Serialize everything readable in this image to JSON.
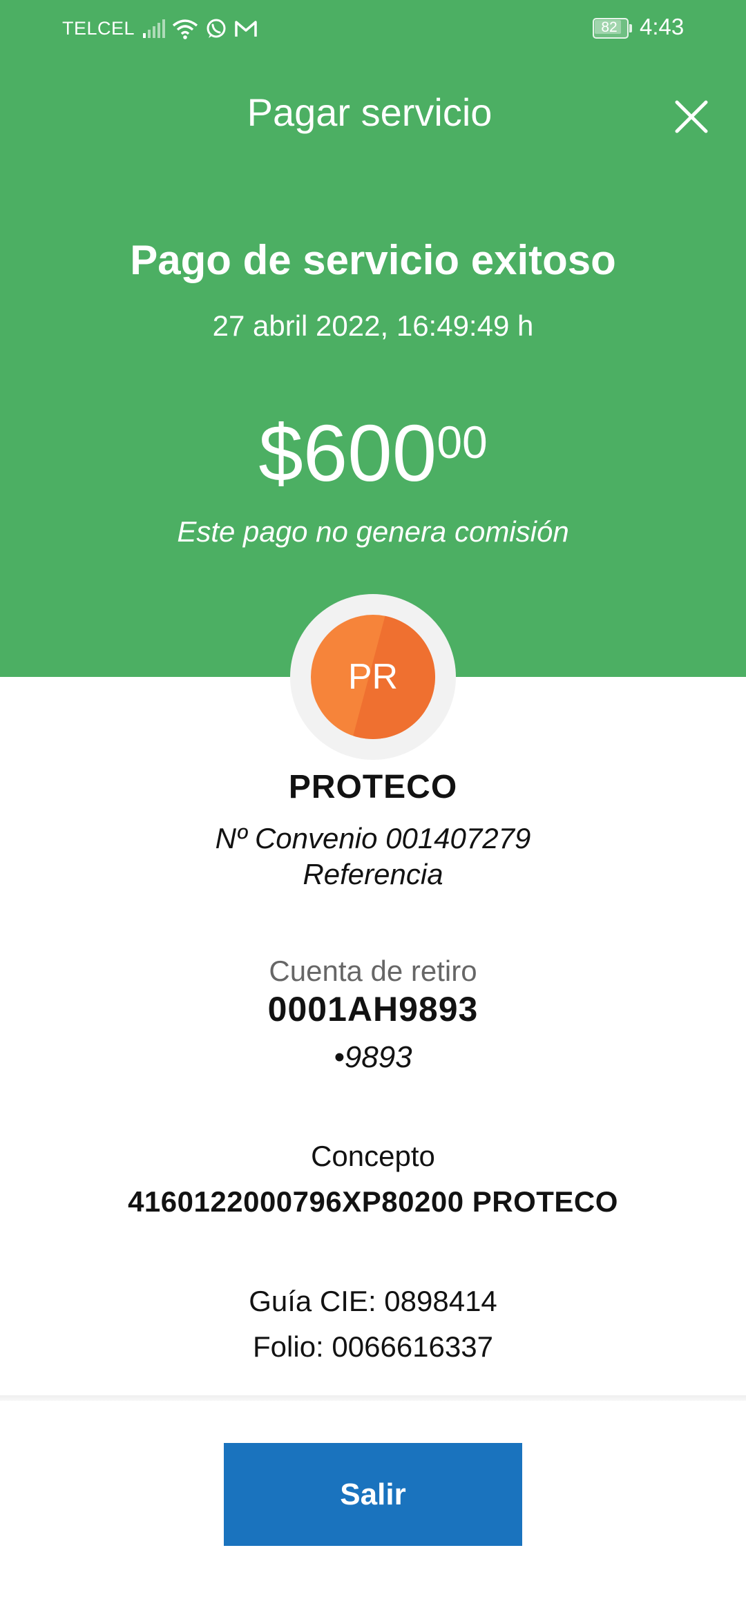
{
  "status_bar": {
    "carrier": "TELCEL",
    "battery_level": "82",
    "time": "4:43",
    "icons": [
      "signal-icon",
      "wifi-icon",
      "whatsapp-icon",
      "gmail-icon",
      "battery-icon"
    ]
  },
  "nav": {
    "title": "Pagar servicio",
    "close_icon": "close-icon"
  },
  "hero": {
    "title": "Pago de servicio exitoso",
    "datetime": "27 abril 2022, 16:49:49 h",
    "amount_currency": "$",
    "amount_integer": "600",
    "amount_cents": "00",
    "commission_note": "Este pago no genera comisión"
  },
  "merchant": {
    "initials": "PR",
    "name": "PROTECO",
    "convenio": "Nº Convenio 001407279",
    "referencia": "Referencia"
  },
  "account": {
    "label": "Cuenta de retiro",
    "value": "0001AH9893",
    "masked": "•9893"
  },
  "concept": {
    "label": "Concepto",
    "value": "4160122000796XP80200 PROTECO"
  },
  "tracking": {
    "guia": "Guía CIE: 0898414",
    "folio": "Folio: 0066616337"
  },
  "actions": {
    "exit_label": "Salir"
  },
  "colors": {
    "header_green": "#4caf63",
    "avatar_orange": "#f6843a",
    "button_blue": "#1a73be"
  }
}
